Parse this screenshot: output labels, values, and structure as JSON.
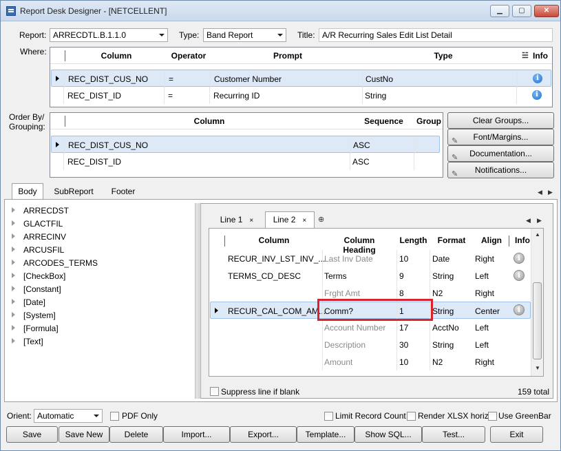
{
  "window": {
    "title": "Report Desk Designer - [NETCELLENT]",
    "min_glyph": "▁",
    "max_glyph": "▢",
    "close_glyph": "✕"
  },
  "header": {
    "report_label": "Report:",
    "report_value": "ARRECDTL.B.1.1.0",
    "type_label": "Type:",
    "type_value": "Band Report",
    "title_label": "Title:",
    "title_value": "A/R Recurring Sales Edit List Detail"
  },
  "where": {
    "label": "Where:",
    "columns": [
      "Column",
      "Operator",
      "Prompt",
      "Type",
      "Info"
    ],
    "rows": [
      {
        "column": "REC_DIST_CUS_NO",
        "operator": "=",
        "prompt": "Customer Number",
        "type": "CustNo"
      },
      {
        "column": "REC_DIST_ID",
        "operator": "=",
        "prompt": "Recurring ID",
        "type": "String"
      }
    ]
  },
  "orderby": {
    "label_line1": "Order By/",
    "label_line2": "Grouping:",
    "columns": [
      "Column",
      "Sequence",
      "Group"
    ],
    "rows": [
      {
        "column": "REC_DIST_CUS_NO",
        "sequence": "ASC"
      },
      {
        "column": "REC_DIST_ID",
        "sequence": "ASC"
      }
    ]
  },
  "side_buttons": {
    "clear_groups": "Clear Groups...",
    "font_margins": "Font/Margins...",
    "documentation": "Documentation...",
    "notifications": "Notifications..."
  },
  "section_tabs": [
    "Body",
    "SubReport",
    "Footer"
  ],
  "tree_items": [
    "ARRECDST",
    "GLACTFIL",
    "ARRECINV",
    "ARCUSFIL",
    "ARCODES_TERMS",
    "[CheckBox]",
    "[Constant]",
    "[Date]",
    "[System]",
    "[Formula]",
    "[Text]"
  ],
  "line_tabs": [
    {
      "label": "Line 1",
      "close": "×"
    },
    {
      "label": "Line 2",
      "close": "×"
    }
  ],
  "line_grid": {
    "columns": [
      "Column",
      "Column Heading",
      "Length",
      "Format",
      "Align",
      "Info"
    ],
    "rows": [
      {
        "column": "RECUR_INV_LST_INV_...",
        "heading": "Last Inv Date",
        "length": "10",
        "format": "Date",
        "align": "Right",
        "info": true,
        "heading_dim": true
      },
      {
        "column": "TERMS_CD_DESC",
        "heading": "Terms",
        "length": "9",
        "format": "String",
        "align": "Left",
        "info": true,
        "heading_dim": false
      },
      {
        "column": "",
        "heading": "Frght Amt",
        "length": "8",
        "format": "N2",
        "align": "Right",
        "info": false,
        "heading_dim": true
      },
      {
        "column": "RECUR_CAL_COM_AM...",
        "heading": "Comm?",
        "length": "1",
        "format": "String",
        "align": "Center",
        "info": true,
        "heading_dim": false
      },
      {
        "column": "",
        "heading": "Account Number",
        "length": "17",
        "format": "AcctNo",
        "align": "Left",
        "info": false,
        "heading_dim": true
      },
      {
        "column": "",
        "heading": "Description",
        "length": "30",
        "format": "String",
        "align": "Left",
        "info": false,
        "heading_dim": true
      },
      {
        "column": "",
        "heading": "Amount",
        "length": "10",
        "format": "N2",
        "align": "Right",
        "info": false,
        "heading_dim": true
      }
    ]
  },
  "suppress_label": "Suppress line if blank",
  "total_label": "159 total",
  "bottom": {
    "orient_label": "Orient:",
    "orient_value": "Automatic",
    "pdf_only": "PDF Only",
    "limit_record_count": "Limit Record Count",
    "render_xlsx": "Render XLSX horiz.",
    "use_greenbar": "Use GreenBar"
  },
  "actions": [
    "Save",
    "Save New",
    "Delete",
    "Import...",
    "Export...",
    "Template...",
    "Show SQL...",
    "Test...",
    "Exit"
  ]
}
